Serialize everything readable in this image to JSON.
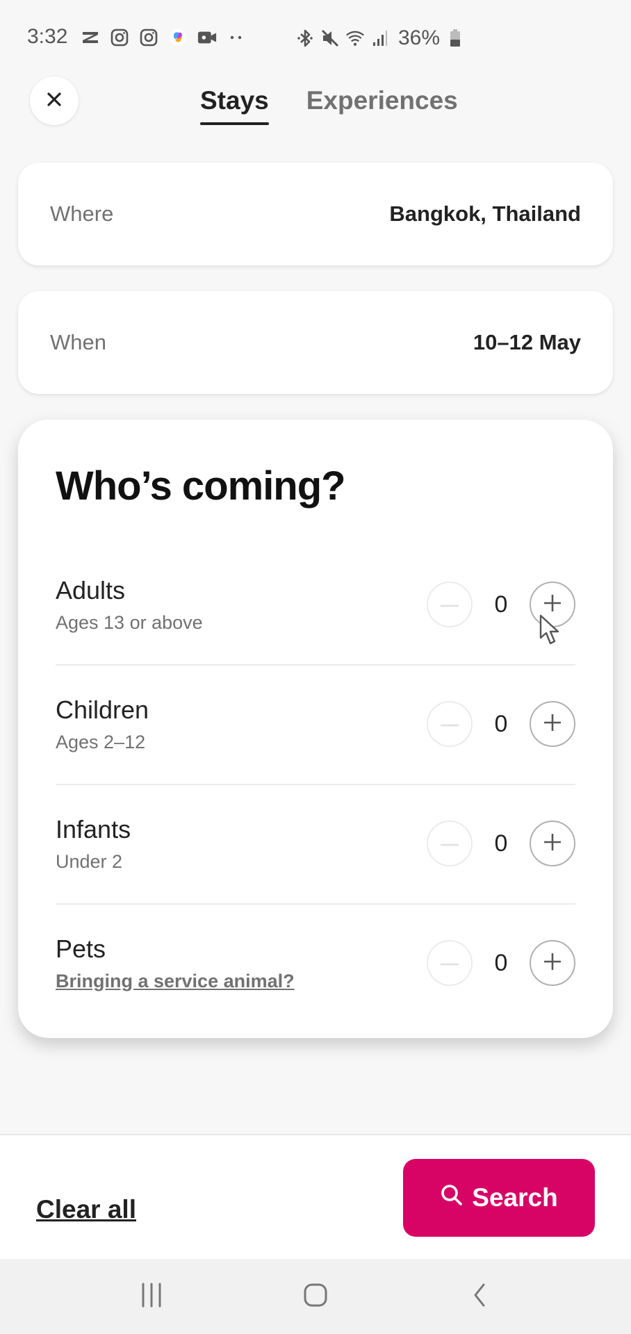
{
  "status_bar": {
    "time": "3:32",
    "left_icons": [
      "capcut-icon",
      "instagram-icon",
      "instagram-icon",
      "copilot-icon",
      "video-camera-icon",
      "more-dots-icon"
    ],
    "right_icons": [
      "bluetooth-icon",
      "mute-icon",
      "wifi-icon",
      "signal-icon"
    ],
    "battery": "36%"
  },
  "header": {
    "close_icon": "close-icon",
    "tabs": [
      {
        "label": "Stays",
        "active": true
      },
      {
        "label": "Experiences",
        "active": false
      }
    ]
  },
  "where": {
    "label": "Where",
    "value": "Bangkok, Thailand"
  },
  "when": {
    "label": "When",
    "value": "10–12 May"
  },
  "guests": {
    "title": "Who’s coming?",
    "rows": [
      {
        "name": "Adults",
        "desc": "Ages 13 or above",
        "count": "0"
      },
      {
        "name": "Children",
        "desc": "Ages 2–12",
        "count": "0"
      },
      {
        "name": "Infants",
        "desc": "Under 2",
        "count": "0"
      },
      {
        "name": "Pets",
        "desc": "Bringing a service animal?",
        "count": "0"
      }
    ]
  },
  "footer": {
    "clear_label": "Clear all",
    "search_label": "Search",
    "accent_color": "#d70466"
  },
  "nav_bar": {
    "buttons": [
      "recent-apps-icon",
      "home-icon",
      "back-icon"
    ]
  }
}
